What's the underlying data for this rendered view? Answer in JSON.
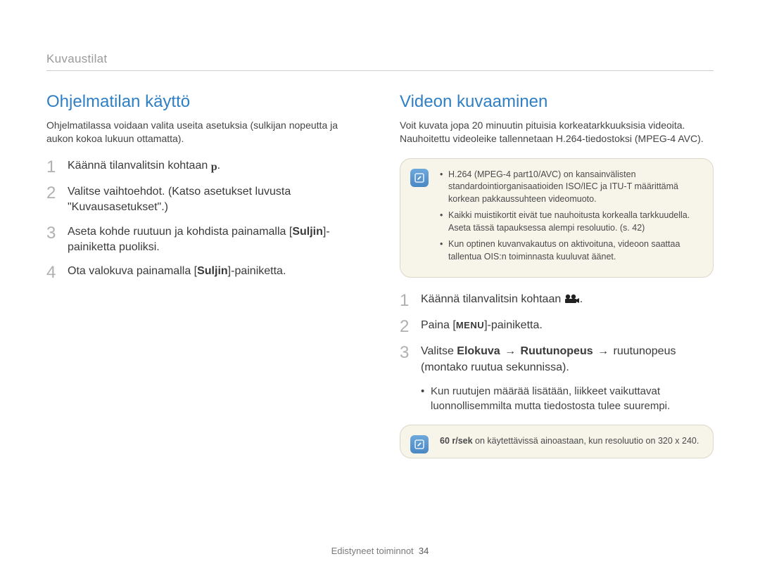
{
  "breadcrumb": "Kuvaustilat",
  "left": {
    "title": "Ohjelmatilan käyttö",
    "intro": "Ohjelmatilassa voidaan valita useita asetuksia (sulkijan nopeutta ja aukon kokoa lukuun ottamatta).",
    "steps": {
      "n1": "1",
      "s1_a": "Käännä tilanvalitsin kohtaan ",
      "s1_b": ".",
      "n2": "2",
      "s2": "Valitse vaihtoehdot. (Katso asetukset luvusta \"Kuvausasetukset\".)",
      "n3": "3",
      "s3_a": "Aseta kohde ruutuun ja kohdista painamalla [",
      "s3_bold": "Suljin",
      "s3_b": "]-painiketta puoliksi.",
      "n4": "4",
      "s4_a": "Ota valokuva painamalla [",
      "s4_bold": "Suljin",
      "s4_b": "]-painiketta."
    }
  },
  "right": {
    "title": "Videon kuvaaminen",
    "intro": "Voit kuvata jopa 20 minuutin pituisia korkeatarkkuuksisia videoita. Nauhoitettu videoleike tallennetaan H.264-tiedostoksi (MPEG-4 AVC).",
    "note1": {
      "li1": "H.264 (MPEG-4 part10/AVC) on kansainvälisten standardointiorganisaatioiden ISO/IEC ja ITU-T määrittämä korkean pakkaussuhteen videomuoto.",
      "li2": "Kaikki muistikortit eivät tue nauhoitusta korkealla tarkkuudella. Aseta tässä tapauksessa alempi resoluutio. (s. 42)",
      "li3": "Kun optinen kuvanvakautus on aktivoituna, videoon saattaa tallentua OIS:n toiminnasta kuuluvat äänet."
    },
    "steps": {
      "n1": "1",
      "s1_a": "Käännä tilanvalitsin kohtaan ",
      "s1_b": ".",
      "n2": "2",
      "s2_a": "Paina [",
      "s2_menu": "MENU",
      "s2_b": "]-painiketta.",
      "n3": "3",
      "s3_a": "Valitse ",
      "s3_b1": "Elokuva",
      "s3_arrow": " → ",
      "s3_b2": "Ruutunopeus",
      "s3_c": " ruutunopeus (montako ruutua sekunnissa)."
    },
    "sub_bullet": "Kun ruutujen määrää lisätään, liikkeet vaikuttavat luonnollisemmilta mutta tiedostosta tulee suurempi.",
    "note2_bold": "60 r/sek",
    "note2_text": " on käytettävissä ainoastaan, kun resoluutio on 320 x 240."
  },
  "footer": {
    "label": "Edistyneet toiminnot",
    "page": "34"
  }
}
